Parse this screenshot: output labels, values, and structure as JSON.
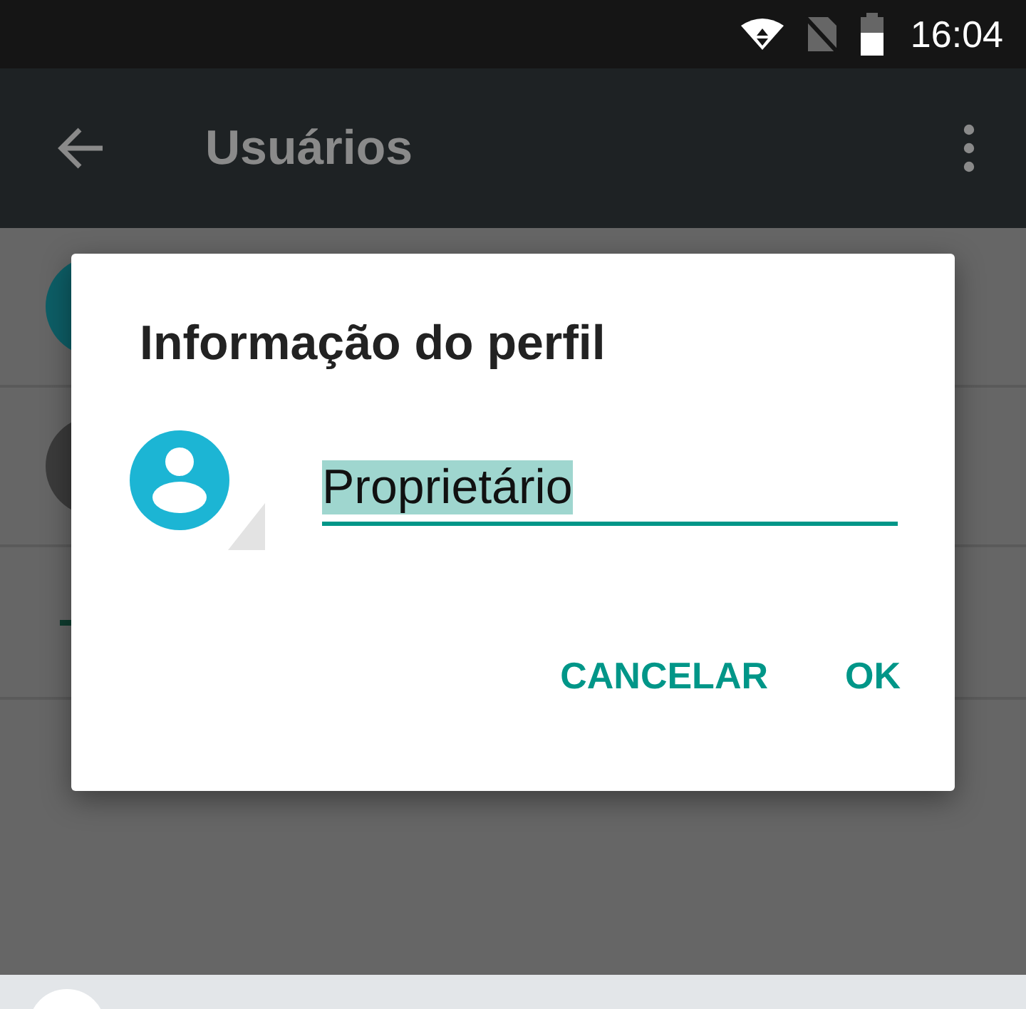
{
  "status_bar": {
    "time": "16:04"
  },
  "app_bar": {
    "title": "Usuários"
  },
  "list": [
    {
      "kind": "avatar",
      "color": "#0d5e66"
    },
    {
      "kind": "avatar",
      "color": "#3b3b3b"
    },
    {
      "kind": "add"
    }
  ],
  "dialog": {
    "title": "Informação do perfil",
    "name_field": {
      "value": "Proprietário",
      "text_selected": true
    },
    "buttons": [
      "CANCELAR",
      "OK"
    ]
  }
}
